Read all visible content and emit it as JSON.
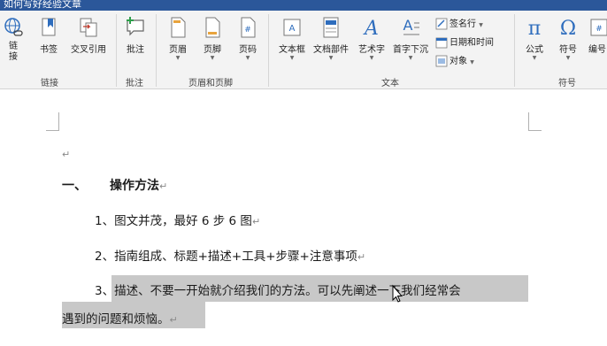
{
  "window": {
    "title": "如何写好经验文章"
  },
  "ribbon": {
    "link_group": {
      "link_label": "链\n接",
      "bookmark_label": "书签",
      "crossref_label": "交叉引用",
      "group_label": "链接"
    },
    "comment_group": {
      "comment_label": "批注",
      "group_label": "批注"
    },
    "header_footer_group": {
      "header_label": "页眉",
      "footer_label": "页脚",
      "page_number_label": "页码",
      "group_label": "页眉和页脚"
    },
    "text_group": {
      "textbox_label": "文本框",
      "docparts_label": "文档部件",
      "wordart_label": "艺术字",
      "dropcap_label": "首字下沉",
      "signature_label": "签名行",
      "datetime_label": "日期和时间",
      "object_label": "对象",
      "group_label": "文本"
    },
    "symbols_group": {
      "equation_label": "公式",
      "symbol_label": "符号",
      "number_label": "编号",
      "group_label": "符号"
    }
  },
  "document": {
    "heading_number": "一、",
    "heading_text": "操作方法",
    "items": [
      "1、图文并茂，最好 6 步 6 图",
      "2、指南组成、标题+描述+工具+步骤+注意事项",
      "3、描述、不要一开始就介绍我们的方法。可以先阐述一下我们经常会"
    ],
    "continuation": "遇到的问题和烦恼。",
    "paragraph_mark": "↵"
  },
  "colors": {
    "titlebar": "#2b579a",
    "ribbon": "#f3f3f3",
    "selection": "#c8c8c8",
    "icon_blue": "#2e6dbd"
  }
}
